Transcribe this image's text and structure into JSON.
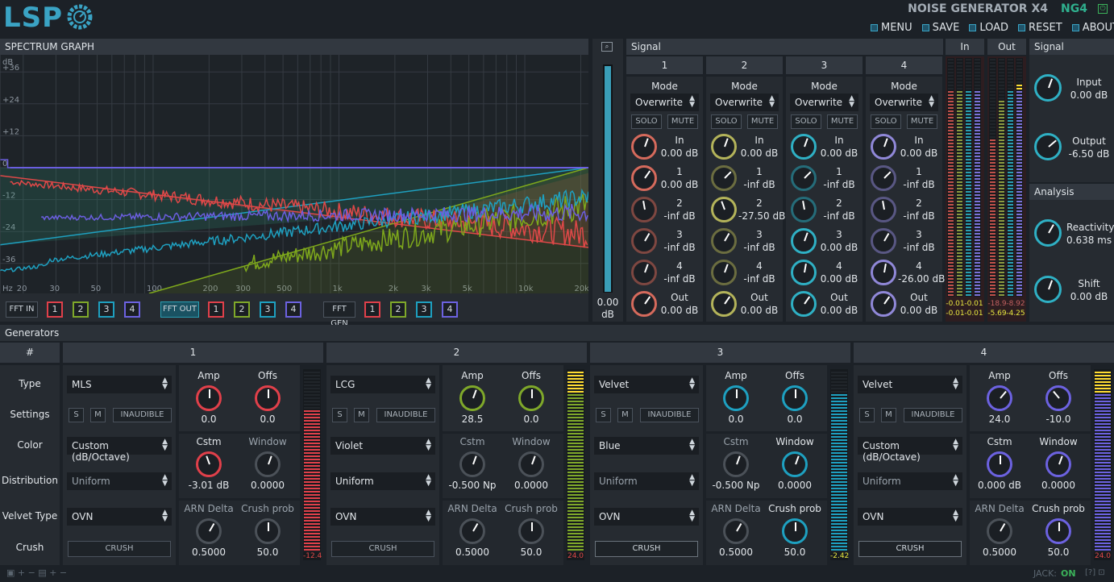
{
  "app": {
    "logo": "LSP",
    "title": "NOISE GENERATOR X4",
    "code": "NG4"
  },
  "menu": [
    {
      "label": "MENU",
      "icon": "menu-icon"
    },
    {
      "label": "SAVE",
      "icon": "save-icon"
    },
    {
      "label": "LOAD",
      "icon": "load-icon"
    },
    {
      "label": "RESET",
      "icon": "reset-icon"
    },
    {
      "label": "ABOUT",
      "icon": "about-icon"
    }
  ],
  "spectrum": {
    "title": "SPECTRUM GRAPH",
    "db_unit": "dB",
    "y_ticks": [
      "+36",
      "+24",
      "+12",
      "0",
      "-12",
      "-24",
      "-36"
    ],
    "x_ticks": [
      "Hz",
      "20",
      "30",
      "50",
      "100",
      "200",
      "300",
      "500",
      "1k",
      "2k",
      "3k",
      "5k",
      "10k",
      "20k"
    ],
    "traces": {
      "red": "#e04848",
      "green": "#7ea81c",
      "cyan": "#1ea0c0",
      "purple": "#6b5ee0"
    }
  },
  "fft": {
    "in": {
      "label": "FFT IN",
      "channels": [
        "1",
        "2",
        "3",
        "4"
      ]
    },
    "out": {
      "label": "FFT OUT",
      "channels": [
        "1",
        "2",
        "3",
        "4"
      ]
    },
    "gen": {
      "label": "FFT GEN",
      "channels": [
        "1",
        "2",
        "3",
        "4"
      ]
    }
  },
  "gain_fader": {
    "value": "0.00",
    "unit": "dB"
  },
  "signal_matrix": {
    "title": "Signal",
    "mode_label": "Mode",
    "solo": "SOLO",
    "mute": "MUTE",
    "channels": [
      {
        "n": "1",
        "color": "#d56a5c",
        "mode": "Overwrite",
        "knobs": [
          [
            "In",
            "0.00 dB"
          ],
          [
            "1",
            "0.00 dB"
          ],
          [
            "2",
            "-inf dB"
          ],
          [
            "3",
            "-inf dB"
          ],
          [
            "4",
            "-inf dB"
          ],
          [
            "Out",
            "0.00 dB"
          ]
        ]
      },
      {
        "n": "2",
        "color": "#b3b35a",
        "mode": "Overwrite",
        "knobs": [
          [
            "In",
            "0.00 dB"
          ],
          [
            "1",
            "-inf dB"
          ],
          [
            "2",
            "-27.50 dB"
          ],
          [
            "3",
            "-inf dB"
          ],
          [
            "4",
            "-inf dB"
          ],
          [
            "Out",
            "0.00 dB"
          ]
        ]
      },
      {
        "n": "3",
        "color": "#2fb0c4",
        "mode": "Overwrite",
        "knobs": [
          [
            "In",
            "0.00 dB"
          ],
          [
            "1",
            "-inf dB"
          ],
          [
            "2",
            "-inf dB"
          ],
          [
            "3",
            "0.00 dB"
          ],
          [
            "4",
            "0.00 dB"
          ],
          [
            "Out",
            "0.00 dB"
          ]
        ]
      },
      {
        "n": "4",
        "color": "#9088d8",
        "mode": "Overwrite",
        "knobs": [
          [
            "In",
            "0.00 dB"
          ],
          [
            "1",
            "-inf dB"
          ],
          [
            "2",
            "-inf dB"
          ],
          [
            "3",
            "-inf dB"
          ],
          [
            "4",
            "-26.00 dB"
          ],
          [
            "Out",
            "0.00 dB"
          ]
        ]
      }
    ]
  },
  "meters": {
    "in": {
      "label": "In",
      "vals": [
        "-0.01",
        "-0.01",
        "-0.01",
        "-0.01"
      ]
    },
    "out": {
      "label": "Out",
      "vals": [
        "-18.9",
        "-8.92",
        "-5.69",
        "-4.25"
      ]
    }
  },
  "signal_side": {
    "title": "Signal",
    "input": {
      "label": "Input",
      "value": "0.00 dB"
    },
    "output": {
      "label": "Output",
      "value": "-6.50 dB"
    }
  },
  "analysis": {
    "title": "Analysis",
    "reactivity": {
      "label": "Reactivity",
      "value": "0.638 ms"
    },
    "shift": {
      "label": "Shift",
      "value": "0.00 dB"
    }
  },
  "generators": {
    "title": "Generators",
    "hash": "#",
    "row_labels": [
      "Type",
      "Settings",
      "Color",
      "Distribution",
      "Velvet Type",
      "Crush"
    ],
    "s": "S",
    "m": "M",
    "inaudible": "INAUDIBLE",
    "crush_btn": "CRUSH",
    "k": {
      "amp": "Amp",
      "offs": "Offs",
      "cstm": "Cstm",
      "window": "Window",
      "arn": "ARN Delta",
      "crush_prob": "Crush prob"
    },
    "list": [
      {
        "n": "1",
        "color": "#e0404a",
        "type": "MLS",
        "color_mode": "Custom (dB/Octave)",
        "dist": "Uniform",
        "velvet": "OVN",
        "amp": "0.0",
        "offs": "0.0",
        "cstm": "-3.01 dB",
        "window": "0.0000",
        "arn": "0.5000",
        "crush": "50.0",
        "meter": "-12.4"
      },
      {
        "n": "2",
        "color": "#7fa82a",
        "type": "LCG",
        "color_mode": "Violet",
        "dist": "Uniform",
        "velvet": "OVN",
        "amp": "28.5",
        "offs": "0.0",
        "cstm": "-0.500 Np",
        "window": "0.0000",
        "arn": "0.5000",
        "crush": "50.0",
        "meter": "24.0"
      },
      {
        "n": "3",
        "color": "#1ea0c0",
        "type": "Velvet",
        "color_mode": "Blue",
        "dist": "Uniform",
        "velvet": "OVN",
        "amp": "0.0",
        "offs": "0.0",
        "cstm": "-0.500 Np",
        "window": "0.0000",
        "arn": "0.5000",
        "crush": "50.0",
        "meter": "-2.42"
      },
      {
        "n": "4",
        "color": "#6c62e0",
        "type": "Velvet",
        "color_mode": "Custom (dB/Octave)",
        "dist": "Uniform",
        "velvet": "OVN",
        "amp": "24.0",
        "offs": "-10.0",
        "cstm": "0.000 dB",
        "window": "0.0000",
        "arn": "0.5000",
        "crush": "50.0",
        "meter": "24.0"
      }
    ]
  },
  "statusbar": {
    "jack_label": "JACK:",
    "jack_value": "ON"
  }
}
